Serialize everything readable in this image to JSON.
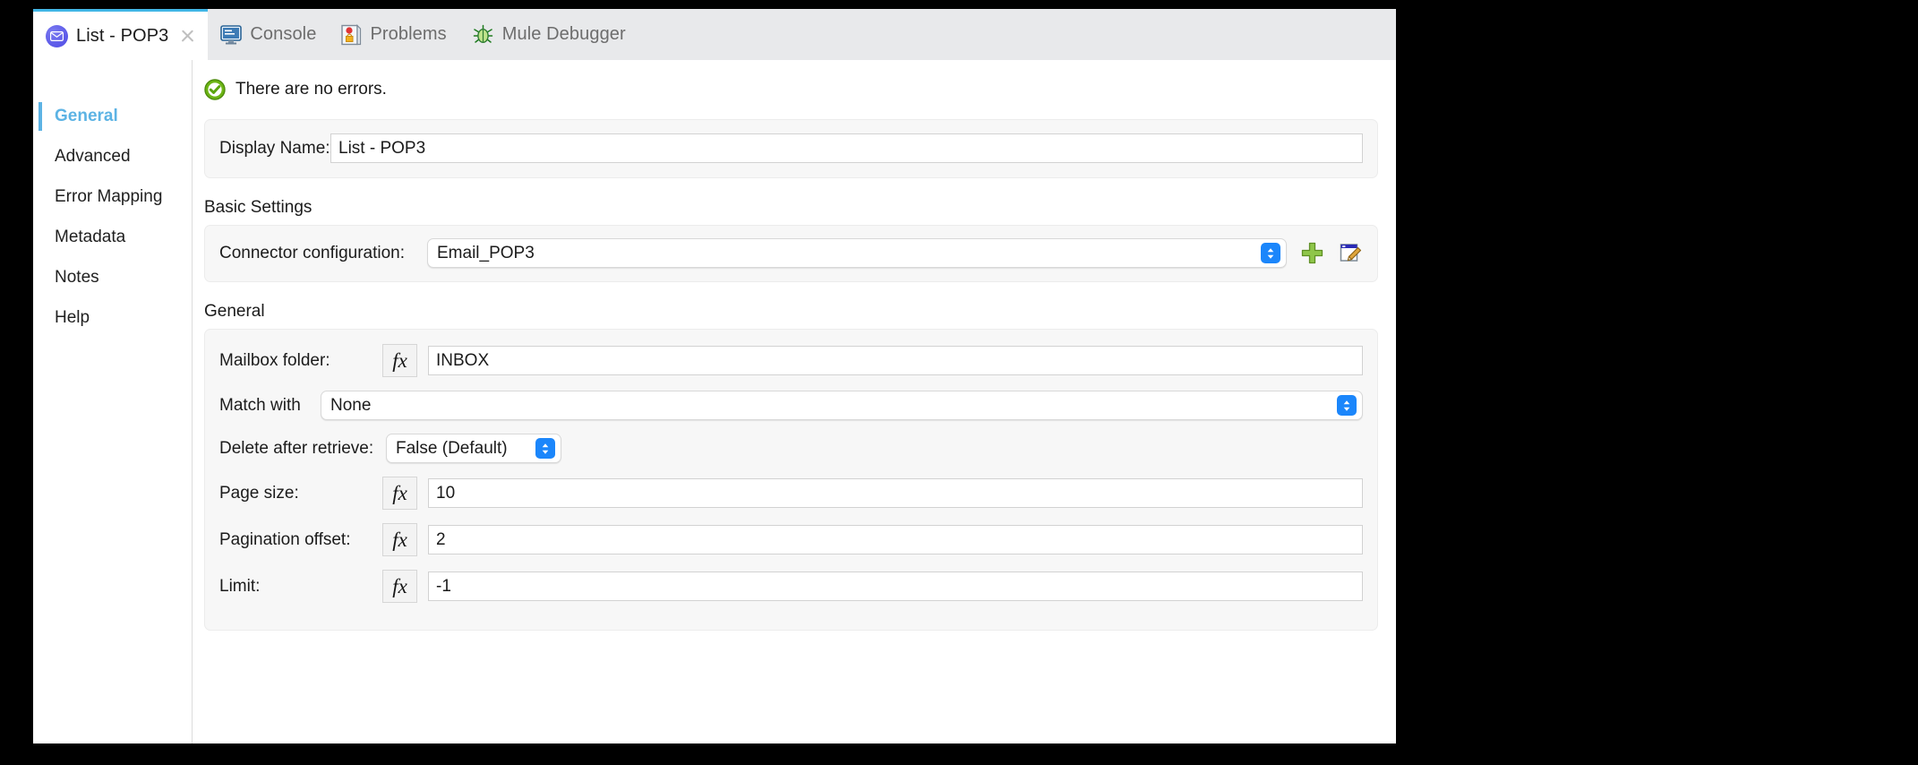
{
  "tabs": [
    {
      "id": "list-pop3",
      "label": "List - POP3",
      "icon": "mail-icon",
      "active": true,
      "closable": true
    },
    {
      "id": "console",
      "label": "Console",
      "icon": "console-icon",
      "active": false,
      "closable": false
    },
    {
      "id": "problems",
      "label": "Problems",
      "icon": "problems-icon",
      "active": false,
      "closable": false
    },
    {
      "id": "mule-debugger",
      "label": "Mule Debugger",
      "icon": "bug-icon",
      "active": false,
      "closable": false
    }
  ],
  "sidebar": {
    "items": [
      {
        "label": "General",
        "active": true
      },
      {
        "label": "Advanced",
        "active": false
      },
      {
        "label": "Error Mapping",
        "active": false
      },
      {
        "label": "Metadata",
        "active": false
      },
      {
        "label": "Notes",
        "active": false
      },
      {
        "label": "Help",
        "active": false
      }
    ]
  },
  "status": {
    "icon": "check-circle-icon",
    "text": "There are no errors."
  },
  "display_name": {
    "label": "Display Name:",
    "value": "List - POP3"
  },
  "basic_settings": {
    "title": "Basic Settings",
    "connector": {
      "label": "Connector configuration:",
      "value": "Email_POP3",
      "add_icon": "plus-icon",
      "edit_icon": "edit-icon"
    }
  },
  "general_section": {
    "title": "General",
    "fields": [
      {
        "label": "Mailbox folder:",
        "type": "fx-text",
        "fx": "fx",
        "value": "INBOX"
      },
      {
        "label": "Match with",
        "type": "popup",
        "value": "None"
      },
      {
        "label": "Delete after retrieve:",
        "type": "popup-short",
        "value": "False (Default)"
      },
      {
        "label": "Page size:",
        "type": "fx-text",
        "fx": "fx",
        "value": "10"
      },
      {
        "label": "Pagination offset:",
        "type": "fx-text",
        "fx": "fx",
        "value": "2"
      },
      {
        "label": "Limit:",
        "type": "fx-text",
        "fx": "fx",
        "value": "-1"
      }
    ]
  },
  "colors": {
    "accent_blue": "#5cb3e4",
    "tab_accent": "#41b6e6",
    "stepper_blue": "#1b86fb",
    "status_green": "#6db515",
    "tabbar_bg": "#e8e9eb",
    "panel_bg": "#f7f7f7"
  }
}
